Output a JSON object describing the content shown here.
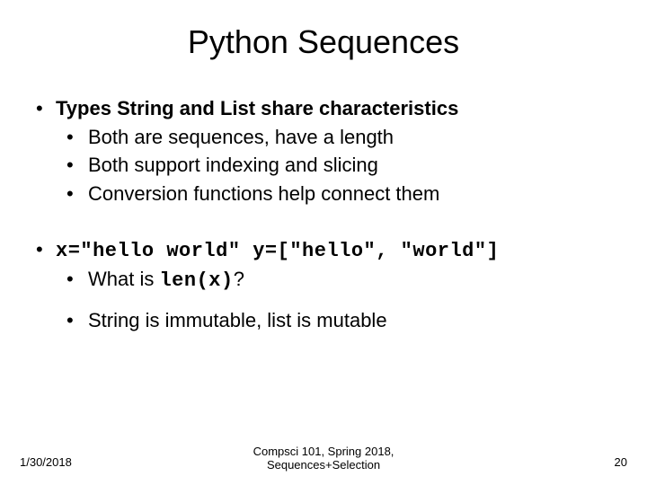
{
  "title": "Python Sequences",
  "block1": {
    "head": "Types String and List share characteristics",
    "items": [
      "Both are sequences, have a length",
      "Both support indexing and slicing",
      "Conversion functions help connect them"
    ]
  },
  "block2": {
    "code": "x=\"hello world\" y=[\"hello\", \"world\"]",
    "q_prefix": "What is ",
    "q_code": "len(x)",
    "q_suffix": "?",
    "item2": "String is immutable, list is mutable"
  },
  "footer": {
    "date": "1/30/2018",
    "center1": "Compsci 101, Spring 2018,",
    "center2": "Sequences+Selection",
    "page": "20"
  }
}
